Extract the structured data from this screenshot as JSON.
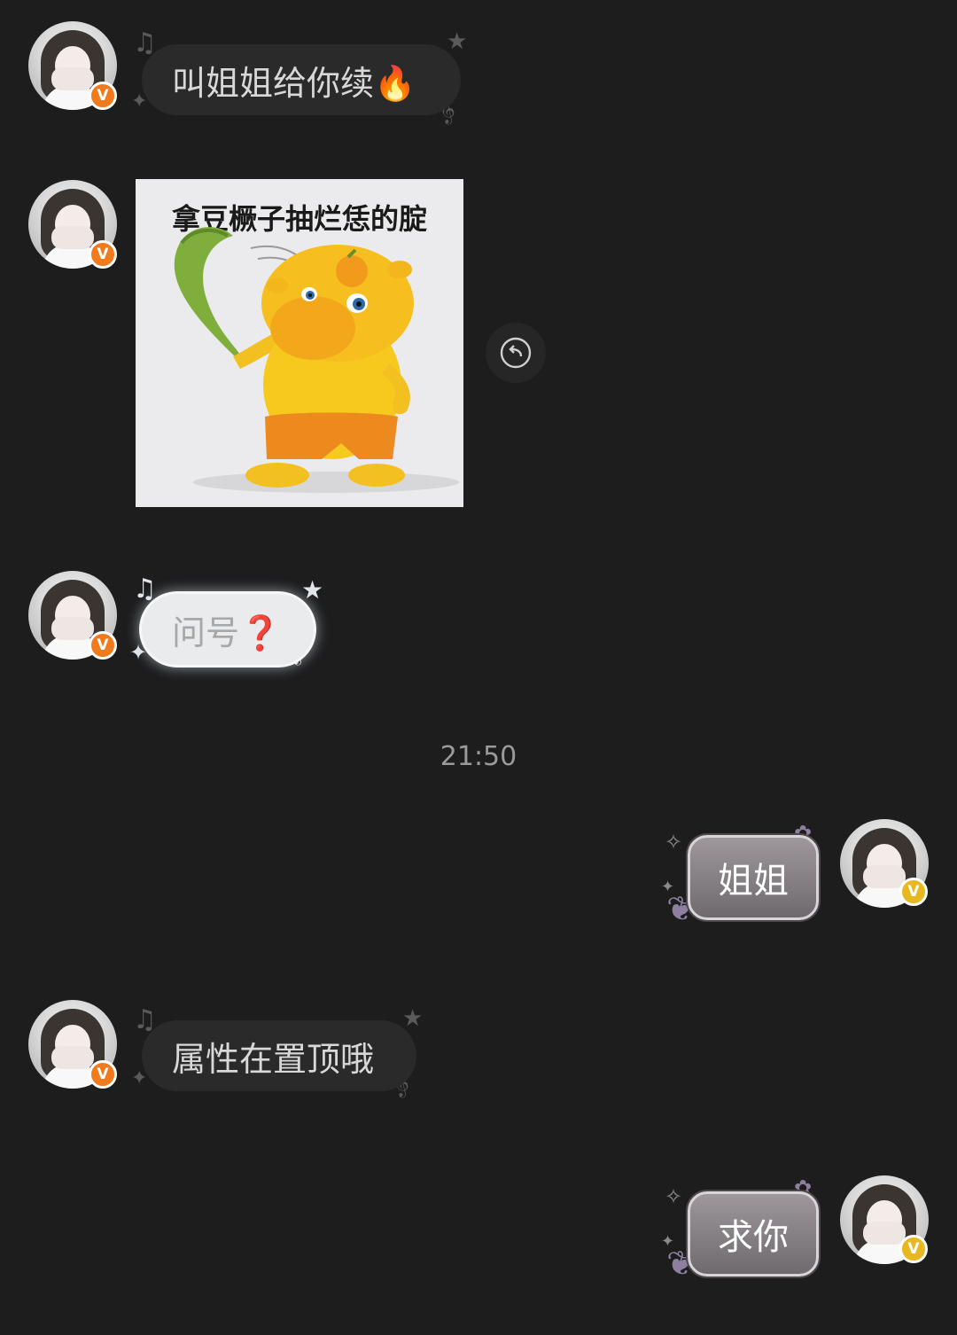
{
  "messages": [
    {
      "side": "received",
      "text": "叫姐姐给你续🔥"
    },
    {
      "side": "received",
      "sticker_caption": "拿豆橛子抽烂恁的腚"
    },
    {
      "side": "received",
      "text": "问号❓"
    },
    {
      "side": "sent",
      "text": "姐姐"
    },
    {
      "side": "received",
      "text": "属性在置顶哦"
    },
    {
      "side": "sent",
      "text": "求你"
    }
  ],
  "timestamp": "21:50",
  "badges": {
    "contact": "V",
    "self": "V"
  },
  "colors": {
    "background": "#1d1d1e",
    "bubble_dark": "#2a2a2b",
    "badge_orange": "#f07a1c",
    "badge_gold": "#e8b820"
  },
  "icons": {
    "refresh": "undo-arrow-icon"
  }
}
